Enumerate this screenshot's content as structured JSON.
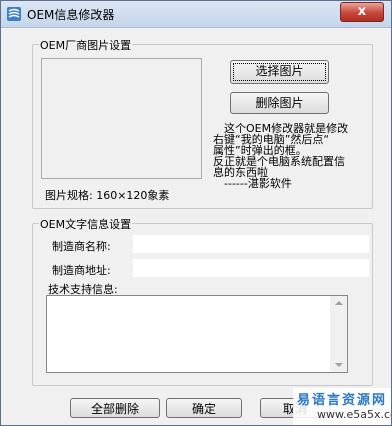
{
  "window": {
    "title": "OEM信息修改器",
    "close_glyph": "x"
  },
  "picture_group": {
    "legend": "OEM厂商图片设置",
    "select_button": "选择图片",
    "delete_button": "删除图片",
    "spec_text": "图片规格: 160×120象素",
    "description_lines": [
      "这个OEM修改器就是修改",
      "右键“我的电脑”然后点“",
      "属性”时弹出的框。",
      "反正就是个电脑系统配置信",
      "息的东西啦",
      "------湛影软件"
    ]
  },
  "text_group": {
    "legend": "OEM文字信息设置",
    "manufacturer_label": "制造商名称:",
    "manufacturer_value": "",
    "address_label": "制造商地址:",
    "address_value": "",
    "support_label": "技术支持信息:",
    "support_value": ""
  },
  "footer": {
    "delete_all_button": "全部删除",
    "ok_button": "确定",
    "cancel_button": "取消"
  },
  "watermark": {
    "site_name": "易语言资源网",
    "url": "www.e5a5x.com"
  }
}
